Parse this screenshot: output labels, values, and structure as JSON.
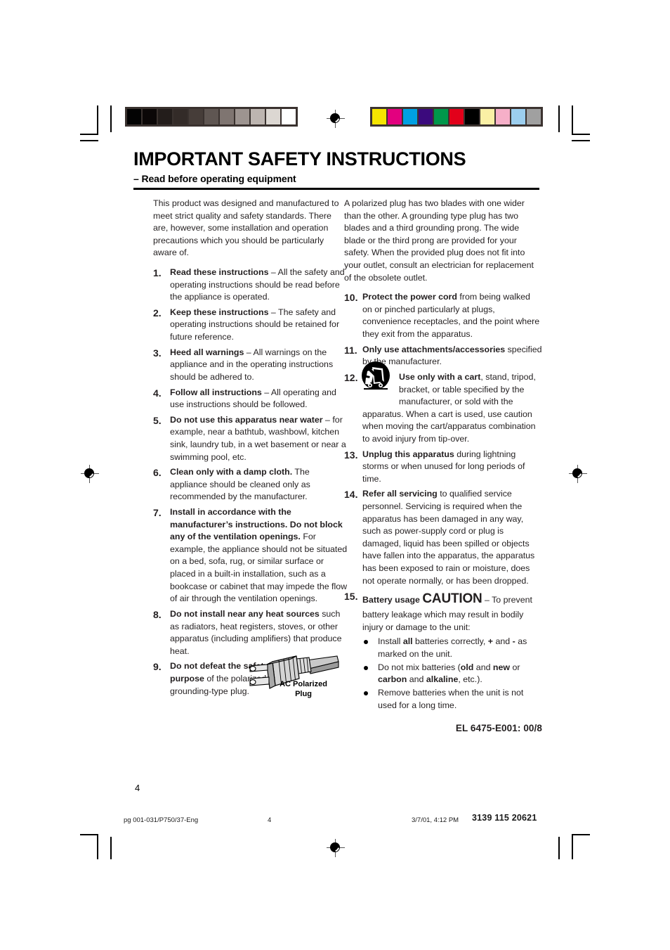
{
  "document": {
    "title": "IMPORTANT SAFETY INSTRUCTIONS",
    "subtitle": "– Read before operating equipment",
    "page_number": "4",
    "doc_code": "EL 6475-E001: 00/8"
  },
  "intro": "This product was designed and manufactured to meet strict quality and safety standards. There are, however, some installation and operation precautions which you should be particularly aware of.",
  "left_column": {
    "items": [
      {
        "number": "1.",
        "lead": "Read these instructions",
        "body": " – All the safety and operating instructions should be read before the appliance is operated."
      },
      {
        "number": "2.",
        "lead": "Keep these instructions",
        "body": " – The safety and operating instructions should be retained for future reference."
      },
      {
        "number": "3.",
        "lead": "Heed all warnings",
        "body": " – All warnings on the appliance and in the operating instructions should be adhered to."
      },
      {
        "number": "4.",
        "lead": "Follow all instructions",
        "body": " – All operating and use instructions should be followed."
      },
      {
        "number": "5.",
        "lead": "Do not use this apparatus near water",
        "body": " – for example, near a bathtub, washbowl, kitchen sink, laundry tub, in a wet basement or near a swimming pool, etc."
      },
      {
        "number": "6.",
        "lead": "Clean only with a damp cloth.",
        "body": " The appliance should be cleaned only as recommended by the manufacturer."
      },
      {
        "number": "7.",
        "lead": "Install in accordance with the manufacturer’s instructions. Do not block any of the ventilation openings.",
        "body": " For example, the appliance should not be situated on a bed, sofa, rug, or similar surface or placed in a built-in installation, such as a bookcase or cabinet that may impede the flow of air through the ventilation openings."
      },
      {
        "number": "8.",
        "lead": "Do not install near any heat sources",
        "body": " such as radiators, heat registers, stoves, or other apparatus (including amplifiers) that produce heat."
      },
      {
        "number": "9.",
        "lead": "Do not defeat the safety purpose",
        "body": " of the polarized or grounding-type plug."
      }
    ]
  },
  "plug_figure": {
    "caption_line1": "AC Polarized",
    "caption_line2": "Plug"
  },
  "right_column": {
    "intro": "A polarized plug has two blades with one wider than the other. A grounding type plug has two blades and a third grounding prong. The wide blade or the third  prong are provided for your safety. When the provided plug does not fit into your outlet, consult an electrician for replacement of the obsolete outlet.",
    "items": [
      {
        "number": "10.",
        "lead": "Protect the power cord",
        "body": " from being walked on or pinched particularly at plugs, convenience receptacles, and the point where they exit from the apparatus."
      },
      {
        "number": "11.",
        "lead": "Only use attachments/accessories",
        "body": " specified by the manufacturer."
      },
      {
        "number": "12.",
        "lead": "Use only with a cart",
        "body": ", stand, tripod, bracket, or table specified by the manufacturer, or sold with the apparatus. When a cart is used, use caution when moving the cart/apparatus combination to avoid injury from tip-over."
      },
      {
        "number": "13.",
        "lead": "Unplug this apparatus",
        "body": " during lightning storms or when unused for long periods of time."
      },
      {
        "number": "14.",
        "lead": "Refer all servicing",
        "body": " to qualified service personnel. Servicing is required when the apparatus has been damaged in any way, such as power-supply cord or plug is damaged, liquid has been spilled or objects have fallen into the apparatus, the apparatus has been exposed to rain or moisture, does not operate normally, or has been dropped."
      }
    ],
    "battery_item": {
      "number": "15.",
      "lead": "Battery usage",
      "caution": "CAUTION",
      "body": " – To prevent battery leakage which may result in bodily injury or damage to the unit:",
      "bullets": [
        {
          "pre": "Install ",
          "bold1": "all",
          "mid1": " batteries correctly, ",
          "bold2": "+",
          "mid2": " and ",
          "bold3": "-",
          "post": " as marked on the unit."
        },
        {
          "pre": "Do not mix batteries (",
          "bold1": "old",
          "mid1": " and ",
          "bold2": "new",
          "mid2": " or ",
          "bold3": "carbon",
          "post": " and ",
          "bold4": "alkaline",
          "tail": ", etc.)."
        },
        {
          "pre": "Remove batteries when the unit is not used for a long time."
        }
      ]
    }
  },
  "footer": {
    "file_name": "pg 001-031/P750/37-Eng",
    "page": "4",
    "date": "3/7/01, 4:12 PM",
    "code": "3139 115 20621"
  },
  "calibration": {
    "grayscale_label": "grayscale-step-wedge",
    "grayscale_swatches": [
      "#030303",
      "#0b0707",
      "#231d1b",
      "#332b28",
      "#463d39",
      "#5f5652",
      "#7f7571",
      "#9d9490",
      "#bdb5b0",
      "#dcd7d2",
      "#ffffff"
    ],
    "color_label": "process-color-bar",
    "color_swatches": [
      "#f5e500",
      "#e3007f",
      "#00a0e3",
      "#3b0a7d",
      "#00974b",
      "#e2001a",
      "#000000",
      "#faf0a5",
      "#f6afc8",
      "#9cceee",
      "#a0a0a0"
    ]
  }
}
